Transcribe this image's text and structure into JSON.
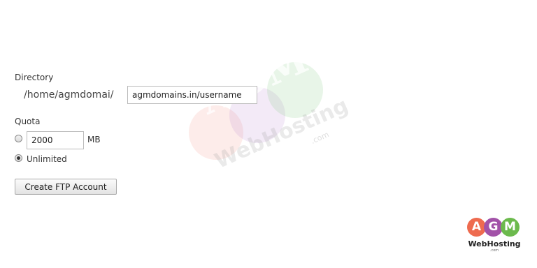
{
  "directory": {
    "label": "Directory",
    "prefix": "/home/agmdomai/",
    "value": "agmdomains.in/username"
  },
  "quota": {
    "label": "Quota",
    "amount_value": "2000",
    "unit": "MB",
    "unlimited_label": "Unlimited",
    "selected_option": "Unlimited"
  },
  "actions": {
    "create_label": "Create FTP Account"
  },
  "watermark": {
    "letters": "AGM",
    "text": "WebHosting",
    "suffix": ".com"
  },
  "logo": {
    "letter_a": "A",
    "letter_g": "G",
    "letter_m": "M",
    "name": "WebHosting",
    "suffix": ".com",
    "colors": {
      "a": "#ee6b4f",
      "g": "#a252a8",
      "m": "#6cba4d"
    }
  }
}
